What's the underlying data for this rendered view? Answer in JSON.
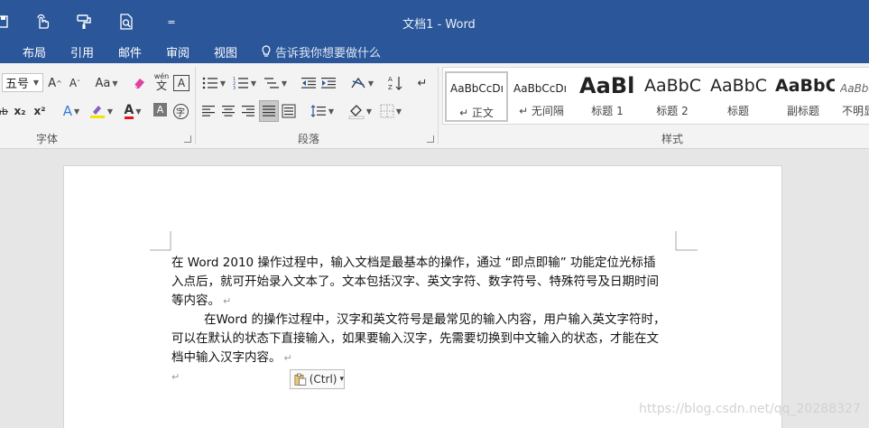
{
  "title_bar": {
    "doc_title": "文档1 - Word",
    "qat_icons": [
      "save-icon",
      "touch-mode-icon",
      "format-painter-icon",
      "print-preview-icon",
      "customize-qat-icon"
    ],
    "dropdown_glyph": "="
  },
  "tabs": [
    {
      "label": "布局"
    },
    {
      "label": "引用"
    },
    {
      "label": "邮件"
    },
    {
      "label": "审阅"
    },
    {
      "label": "视图"
    }
  ],
  "tell_me": "告诉我你想要做什么",
  "font_group": {
    "font_size": "五号",
    "grow": "A",
    "shrink": "A",
    "case": "Aa",
    "phonetic": "wén",
    "phonetic_sub": "文",
    "border_char": "A",
    "strike": "ab",
    "sub": "x₂",
    "sup": "x²",
    "effects": "A",
    "font_color": "A",
    "shade": "A",
    "enclose": "字",
    "label": "字体"
  },
  "paragraph_group": {
    "label": "段落"
  },
  "styles_group": {
    "label": "样式",
    "items": [
      {
        "sample": "AaBbCcDı",
        "name": "↵ 正文"
      },
      {
        "sample": "AaBbCcDı",
        "name": "↵ 无间隔"
      },
      {
        "sample": "AaBl",
        "name": "标题 1"
      },
      {
        "sample": "AaBbC",
        "name": "标题 2"
      },
      {
        "sample": "AaBbC",
        "name": "标题"
      },
      {
        "sample": "AaBbC",
        "name": "副标题"
      },
      {
        "sample": "AaBbC",
        "name": "不明显"
      }
    ]
  },
  "document": {
    "p1_lines": [
      "在 Word 2010 操作过程中，输入文档是最基本的操作，通过 “即点即输” 功能定位光标插",
      "入点后，就可开始录入文本了。文本包括汉字、英文字符、数字符号、特殊符号及日期时间",
      "等内容。"
    ],
    "p2_lines": [
      "在Word 的操作过程中，汉字和英文符号是最常见的输入内容，用户输入英文字符时，",
      "可以在默认的状态下直接输入，如果要输入汉字，先需要切换到中文输入的状态，才能在文",
      "档中输入汉字内容。"
    ],
    "para_mark": "↵",
    "paste_label": "(Ctrl)",
    "paste_caret": "▾"
  },
  "watermark": "https://blog.csdn.net/qq_20288327",
  "colors": {
    "brand": "#2b579a",
    "font_color_bar": "#e81123",
    "highlight_bar": "#f2e600"
  }
}
